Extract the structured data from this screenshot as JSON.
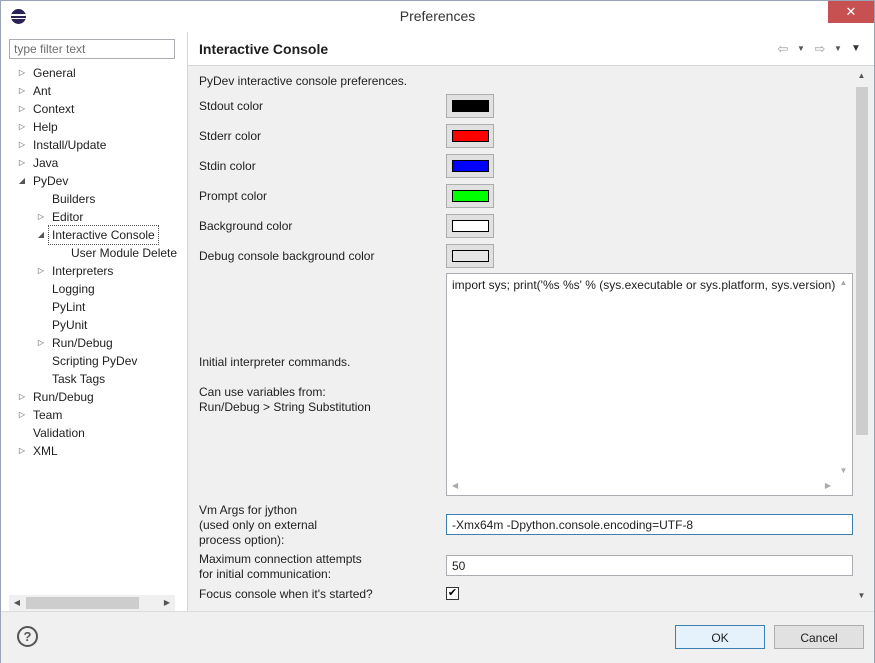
{
  "window": {
    "title": "Preferences",
    "close_glyph": "✕"
  },
  "filter": {
    "placeholder": "type filter text"
  },
  "tree": [
    {
      "label": "General",
      "level": 0,
      "expander": "collapsed",
      "selected": false
    },
    {
      "label": "Ant",
      "level": 0,
      "expander": "collapsed",
      "selected": false
    },
    {
      "label": "Context",
      "level": 0,
      "expander": "collapsed",
      "selected": false
    },
    {
      "label": "Help",
      "level": 0,
      "expander": "collapsed",
      "selected": false
    },
    {
      "label": "Install/Update",
      "level": 0,
      "expander": "collapsed",
      "selected": false
    },
    {
      "label": "Java",
      "level": 0,
      "expander": "collapsed",
      "selected": false
    },
    {
      "label": "PyDev",
      "level": 0,
      "expander": "expanded",
      "selected": false
    },
    {
      "label": "Builders",
      "level": 1,
      "expander": "none",
      "selected": false
    },
    {
      "label": "Editor",
      "level": 1,
      "expander": "collapsed",
      "selected": false
    },
    {
      "label": "Interactive Console",
      "level": 1,
      "expander": "expanded",
      "selected": true
    },
    {
      "label": "User Module Delete",
      "level": 2,
      "expander": "none",
      "selected": false
    },
    {
      "label": "Interpreters",
      "level": 1,
      "expander": "collapsed",
      "selected": false
    },
    {
      "label": "Logging",
      "level": 1,
      "expander": "none",
      "selected": false
    },
    {
      "label": "PyLint",
      "level": 1,
      "expander": "none",
      "selected": false
    },
    {
      "label": "PyUnit",
      "level": 1,
      "expander": "none",
      "selected": false
    },
    {
      "label": "Run/Debug",
      "level": 1,
      "expander": "collapsed",
      "selected": false
    },
    {
      "label": "Scripting PyDev",
      "level": 1,
      "expander": "none",
      "selected": false
    },
    {
      "label": "Task Tags",
      "level": 1,
      "expander": "none",
      "selected": false
    },
    {
      "label": "Run/Debug",
      "level": 0,
      "expander": "collapsed",
      "selected": false
    },
    {
      "label": "Team",
      "level": 0,
      "expander": "collapsed",
      "selected": false
    },
    {
      "label": "Validation",
      "level": 0,
      "expander": "none",
      "selected": false
    },
    {
      "label": "XML",
      "level": 0,
      "expander": "collapsed",
      "selected": false
    }
  ],
  "page": {
    "title": "Interactive Console",
    "description": "PyDev interactive console preferences.",
    "colors": [
      {
        "label": "Stdout color",
        "swatch": "#000000",
        "name": "stdout"
      },
      {
        "label": "Stderr color",
        "swatch": "#ff0000",
        "name": "stderr"
      },
      {
        "label": "Stdin color",
        "swatch": "#0000ff",
        "name": "stdin"
      },
      {
        "label": "Prompt color",
        "swatch": "#00ff00",
        "name": "prompt"
      },
      {
        "label": "Background color",
        "swatch": "#ffffff",
        "name": "background"
      },
      {
        "label": "Debug console background color",
        "swatch": "#e6e6e6",
        "name": "debug-background"
      }
    ],
    "initial_commands": {
      "label": "Initial interpreter commands.",
      "value": "import sys; print('%s %s' % (sys.executable or sys.platform, sys.version))"
    },
    "variables_note_1": "Can use variables from:",
    "variables_note_2": "Run/Debug > String Substitution",
    "vm_args": {
      "label_1": "Vm Args for jython",
      "label_2": "(used only on external",
      "label_3": "process option):",
      "value": "-Xmx64m -Dpython.console.encoding=UTF-8"
    },
    "max_attempts": {
      "label_1": "Maximum connection attempts",
      "label_2": "for initial communication:",
      "value": "50"
    },
    "focus_console": {
      "label": "Focus console when it's started?",
      "checked": true
    }
  },
  "buttons": {
    "ok": "OK",
    "cancel": "Cancel",
    "help": "?"
  }
}
